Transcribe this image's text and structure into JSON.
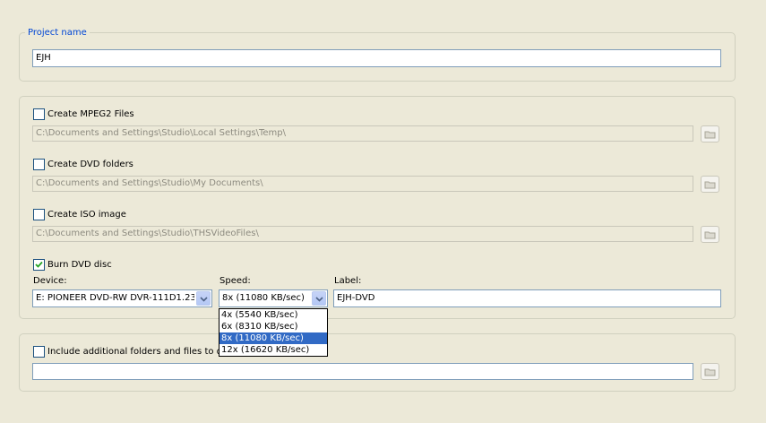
{
  "project": {
    "legend": "Project name",
    "name_value": "EJH"
  },
  "output": {
    "mpeg2": {
      "label": "Create MPEG2 Files",
      "checked": false,
      "path": "C:\\Documents and Settings\\Studio\\Local Settings\\Temp\\"
    },
    "dvd_folders": {
      "label": "Create DVD folders",
      "checked": false,
      "path": "C:\\Documents and Settings\\Studio\\My Documents\\"
    },
    "iso": {
      "label": "Create ISO image",
      "checked": false,
      "path": "C:\\Documents and Settings\\Studio\\THSVideoFiles\\"
    },
    "burn": {
      "label": "Burn DVD disc",
      "checked": true,
      "device_label": "Device:",
      "device_value": "E:  PIONEER DVD-RW  DVR-111D1.23",
      "speed_label": "Speed:",
      "speed_value": "8x (11080 KB/sec)",
      "disc_label_label": "Label:",
      "disc_label_value": "EJH-DVD",
      "speed_options": [
        "4x (5540 KB/sec)",
        "6x (8310 KB/sec)",
        "8x (11080 KB/sec)",
        "12x (16620 KB/sec)"
      ],
      "selected_speed_index": 2
    }
  },
  "additional": {
    "label": "Include additional folders and files to disc",
    "checked": false,
    "path": ""
  },
  "icons": {
    "browse": "folder-icon",
    "checkmark": "checkmark-icon",
    "dropdown": "chevron-down-icon"
  },
  "colors": {
    "background": "#ece9d8",
    "legend_text": "#0046d5",
    "selection": "#316ac5",
    "input_border": "#7f9db9"
  }
}
